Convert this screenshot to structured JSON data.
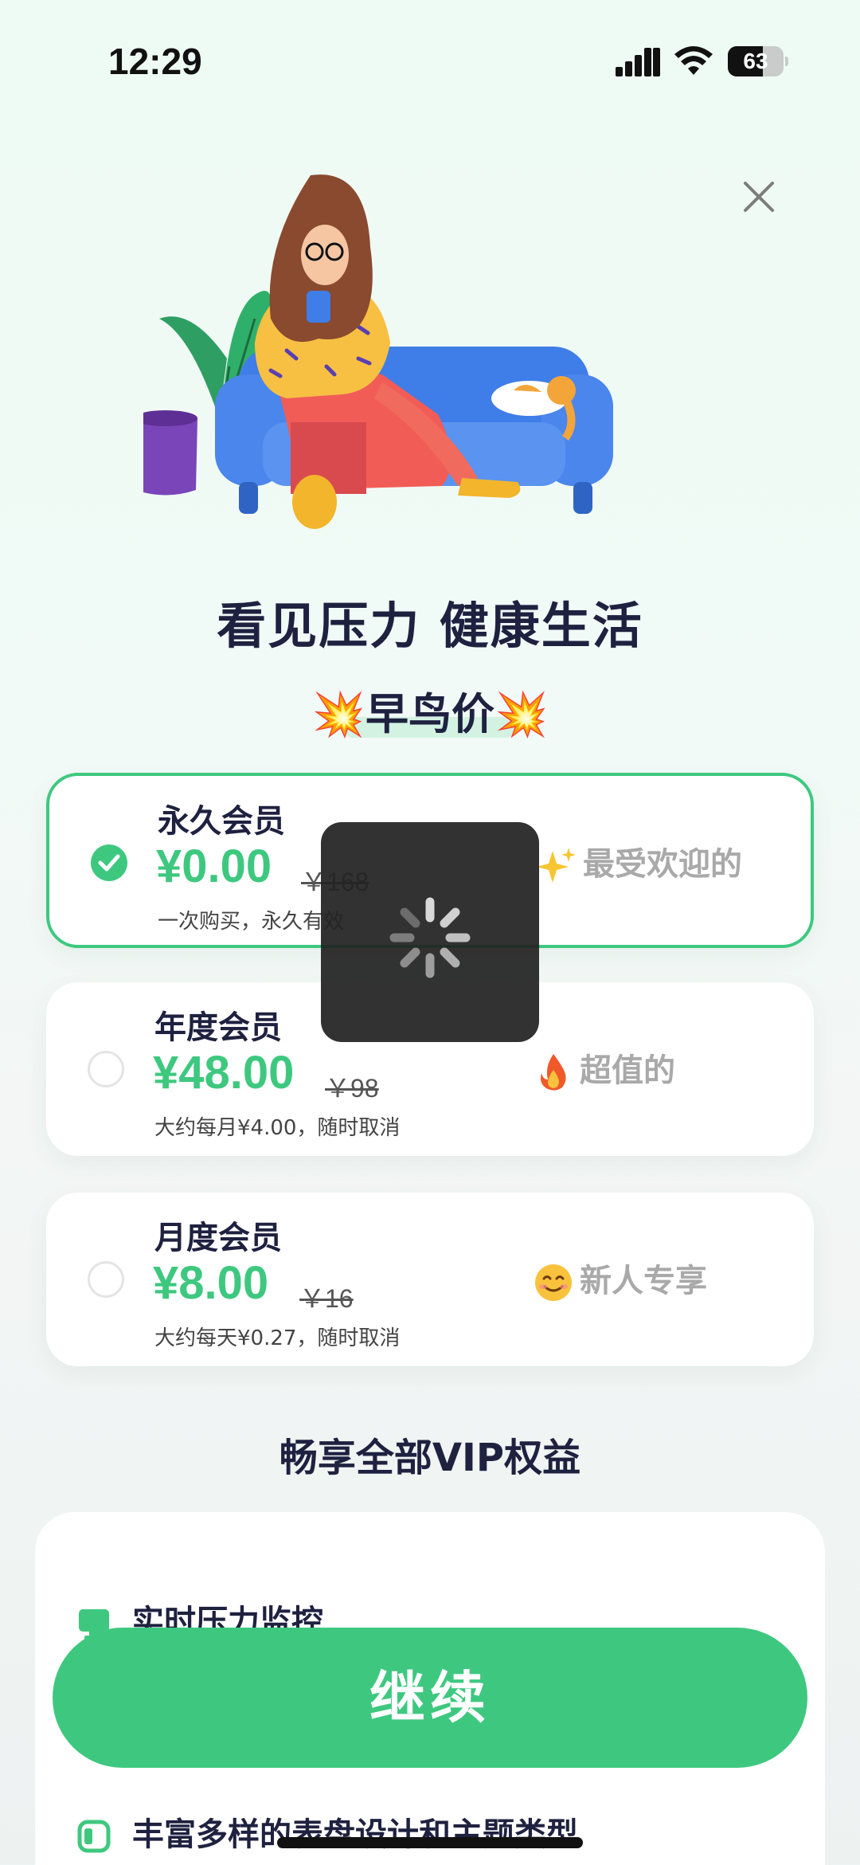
{
  "status_bar": {
    "time": "12:29",
    "battery": "63",
    "battery_level": 0.63
  },
  "header": {
    "close_icon": "close-icon"
  },
  "hero": {
    "headline": "看见压力 健康生活",
    "badge_text": "早鸟价",
    "badge_emoji_left": "💥",
    "badge_emoji_right": "💥"
  },
  "plans": [
    {
      "name": "永久会员",
      "price": "¥0.00",
      "original_price": "￥168",
      "note": "一次购买，永久有效",
      "tag": "最受欢迎的",
      "tag_icon": "sparkles-icon",
      "selected": true
    },
    {
      "name": "年度会员",
      "price": "¥48.00",
      "original_price": "￥98",
      "note": "大约每月¥4.00，随时取消",
      "tag": "超值的",
      "tag_icon": "fire-icon",
      "selected": false
    },
    {
      "name": "月度会员",
      "price": "¥8.00",
      "original_price": "￥16",
      "note": "大约每天¥0.27，随时取消",
      "tag": "新人专享",
      "tag_icon": "smile-icon",
      "selected": false
    }
  ],
  "benefits": {
    "title": "畅享全部VIP权益",
    "items": [
      {
        "label": "实时压力监控",
        "icon": "monitor-icon"
      },
      {
        "label": "丰富多样的表盘设计和主题类型",
        "icon": "watch-face-icon"
      }
    ]
  },
  "cta": {
    "label": "继续"
  },
  "colors": {
    "accent": "#3ec87f",
    "text_dark": "#1f2140",
    "tag_gray": "#a9a9a9"
  }
}
